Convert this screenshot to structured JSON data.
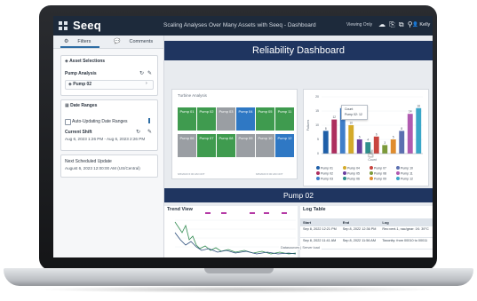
{
  "app": {
    "logo": "Seeq",
    "document_title": "Scaling Analyses Over Many Assets with Seeq - Dashboard",
    "viewing_label": "Viewing Only",
    "toolbar_icons": "☁ ⎘ ⧉ ⚲",
    "user_name": "Kelly"
  },
  "left_panel": {
    "tabs": [
      {
        "label": "Filters",
        "icon": "gear-icon"
      },
      {
        "label": "Comments",
        "icon": "chat-icon"
      }
    ],
    "asset_selections": {
      "heading": "Asset Selections",
      "analysis_label": "Pump Analysis",
      "selected_asset": "Pump 02"
    },
    "date_ranges": {
      "heading": "Date Ranges",
      "auto_update_label": "Auto-Updating Date Ranges",
      "current_shift_label": "Current Shift",
      "current_shift_value": "Aug 6, 2023 1:26 PM - Aug 6, 2023 2:26 PM"
    },
    "next_update": {
      "label": "Next Scheduled Update",
      "value": "August 6, 2023 12:00:00 AM (US/Central)"
    }
  },
  "dashboard": {
    "title": "Reliability Dashboard",
    "section_title": "Pump 02",
    "turbine_title": "Turbine Analysis",
    "turbine_footer_left": "6/6/2023 6:00 AM CDT",
    "turbine_footer_right": "6/6/2023 6:00 AM CDT",
    "tiles": [
      {
        "label": "Pump 01",
        "color": "#3f9b4f"
      },
      {
        "label": "Pump 02",
        "color": "#3f9b4f"
      },
      {
        "label": "Pump 03",
        "color": "#9a9ea3"
      },
      {
        "label": "Pump 04",
        "color": "#2f78c4"
      },
      {
        "label": "Pump 05",
        "color": "#3f9b4f"
      },
      {
        "label": "Pump 11",
        "color": "#3f9b4f"
      },
      {
        "label": "Pump 06",
        "color": "#9a9ea3"
      },
      {
        "label": "Pump 07",
        "color": "#3f9b4f"
      },
      {
        "label": "Pump 08",
        "color": "#3f9b4f"
      },
      {
        "label": "Pump 09",
        "color": "#9a9ea3"
      },
      {
        "label": "Pump 10",
        "color": "#9a9ea3"
      },
      {
        "label": "Pump 12",
        "color": "#2f78c4"
      }
    ],
    "trend_title": "Trend View",
    "log_title": "Log Table",
    "log_columns": [
      "Start",
      "End",
      "Log"
    ],
    "log_rows": [
      [
        "Sep 8, 2022 12:21 PM",
        "Sep 8, 2022 12:36 PM",
        "Rec:vent.1, nac/gear: 1K: 39°C"
      ],
      [
        "Sep 8, 2022 11:41 AM",
        "Sep 8, 2022 11:56 AM",
        "Taxonity: from 00010 to 00011"
      ]
    ],
    "footer_links": "Datasources | Server load"
  },
  "chart_data": {
    "type": "bar",
    "ylabel": "Failures",
    "xlabel": "Count",
    "tooltip_title": "Count",
    "tooltip_value": "Pump 02: 12",
    "categories": [
      "Pump 01",
      "Pump 02",
      "Pump 03",
      "Pump 04",
      "Pump 05",
      "Pump 06",
      "Pump 07",
      "Pump 08",
      "Pump 09",
      "Pump 10",
      "Pump 11",
      "Pump 12"
    ],
    "values": [
      8,
      12,
      16,
      10,
      5,
      4,
      6,
      3,
      5,
      8,
      14,
      16
    ],
    "value_labels": [
      "8",
      "12",
      "16",
      "10",
      "5",
      "4",
      "6",
      "3",
      "5",
      "8",
      "14",
      "16"
    ],
    "colors": [
      "#1f5fa8",
      "#ad2e5e",
      "#3f7ec9",
      "#d4aa2a",
      "#6a3fa0",
      "#2f8f8c",
      "#c8453f",
      "#7c9a3a",
      "#e08c2e",
      "#5b6fb0",
      "#b05ab0",
      "#3aa6c8"
    ],
    "yticks": [
      "20",
      "15",
      "10",
      "5",
      "0"
    ],
    "ylim": [
      0,
      20
    ]
  }
}
